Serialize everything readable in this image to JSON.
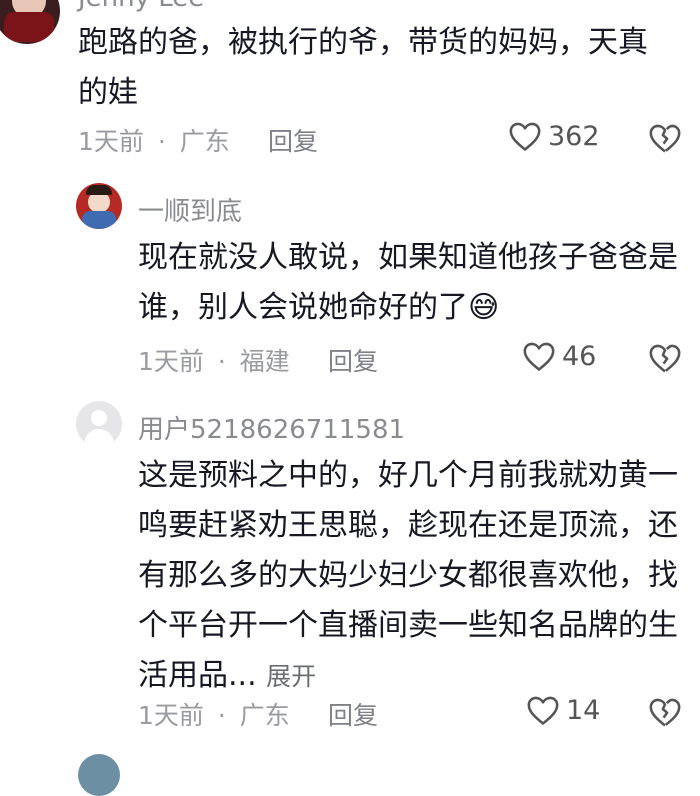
{
  "comments": [
    {
      "user": "Jenny Lee",
      "text": "跑路的爸，被执行的爷，带货的妈妈，天真的娃",
      "time": "1天前",
      "location": "广东",
      "reply_label": "回复",
      "likes": "362"
    },
    {
      "user": "一顺到底",
      "text": "现在就没人敢说，如果知道他孩子爸爸是谁，别人会说她命好的了",
      "emoji": "😅",
      "time": "1天前",
      "location": "福建",
      "reply_label": "回复",
      "likes": "46"
    },
    {
      "user": "用户5218626711581",
      "text": "这是预料之中的，好几个月前我就劝黄一鸣要赶紧劝王思聪，趁现在还是顶流，还有那么多的大妈少妇少女都很喜欢他，找个平台开一个直播间卖一些知名品牌的生活用品...",
      "expand_label": "展开",
      "time": "1天前",
      "location": "广东",
      "reply_label": "回复",
      "likes": "14"
    }
  ],
  "separator": "·",
  "icons": {
    "like": "heart-outline-icon",
    "dislike": "broken-heart-icon",
    "default_avatar": "default-user-avatar-icon"
  },
  "colors": {
    "text": "#161823",
    "meta": "#9a9ba1",
    "username": "#8a8b91"
  }
}
